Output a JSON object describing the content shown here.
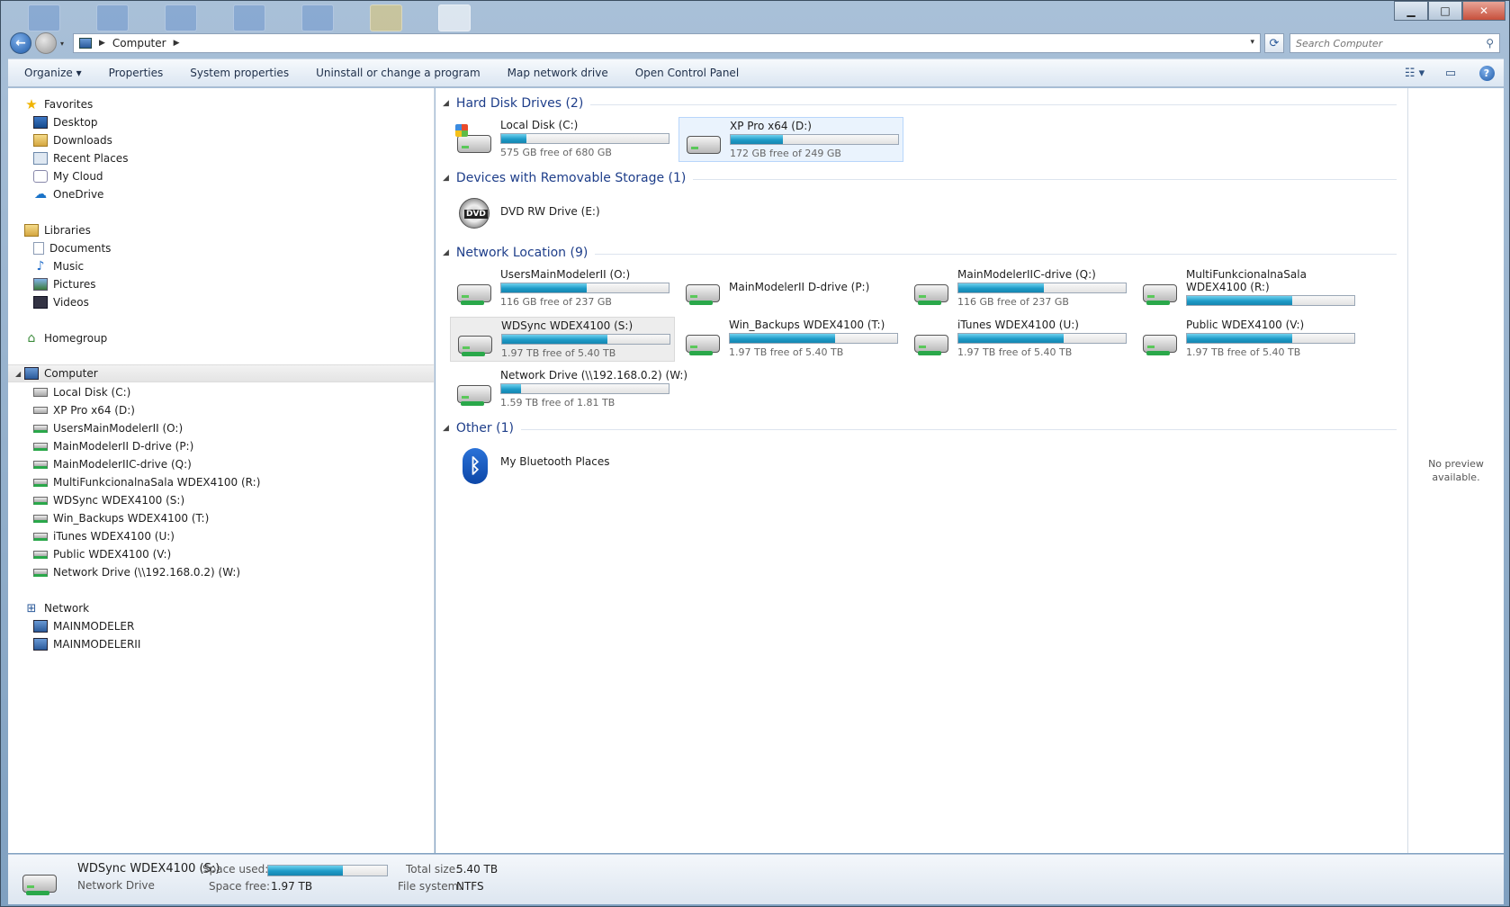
{
  "window": {
    "controls": {
      "minimize": "▁",
      "maximize": "□",
      "close": "✕"
    }
  },
  "address": {
    "crumb": "Computer",
    "search_placeholder": "Search Computer"
  },
  "toolbar": {
    "items": [
      "Organize ▾",
      "Properties",
      "System properties",
      "Uninstall or change a program",
      "Map network drive",
      "Open Control Panel"
    ]
  },
  "nav": {
    "favorites": "Favorites",
    "favorites_items": [
      "Desktop",
      "Downloads",
      "Recent Places",
      "My Cloud",
      "OneDrive"
    ],
    "libraries": "Libraries",
    "libraries_items": [
      "Documents",
      "Music",
      "Pictures",
      "Videos"
    ],
    "homegroup": "Homegroup",
    "computer": "Computer",
    "computer_items": [
      "Local Disk (C:)",
      "XP Pro x64 (D:)",
      "UsersMainModelerII (O:)",
      "MainModelerII D-drive (P:)",
      "MainModelerIIC-drive (Q:)",
      "MultiFunkcionalnaSala WDEX4100 (R:)",
      "WDSync WDEX4100 (S:)",
      "Win_Backups WDEX4100 (T:)",
      "iTunes WDEX4100 (U:)",
      "Public WDEX4100 (V:)",
      "Network Drive (\\\\192.168.0.2) (W:)"
    ],
    "network": "Network",
    "network_items": [
      "MAINMODELER",
      "MAINMODELERII"
    ]
  },
  "groups": {
    "hdd": "Hard Disk Drives (2)",
    "removable": "Devices with Removable Storage (1)",
    "netloc": "Network Location (9)",
    "other": "Other (1)"
  },
  "drives": {
    "c": {
      "name": "Local Disk (C:)",
      "free": "575 GB free of 680 GB",
      "used_pct": 15
    },
    "d": {
      "name": "XP Pro x64 (D:)",
      "free": "172 GB free of 249 GB",
      "used_pct": 31
    },
    "e": {
      "name": "DVD RW Drive (E:)"
    },
    "o": {
      "name": "UsersMainModelerII (O:)",
      "free": "116 GB free of 237 GB",
      "used_pct": 51
    },
    "p": {
      "name": "MainModelerII D-drive (P:)"
    },
    "q": {
      "name": "MainModelerIIC-drive (Q:)",
      "free": "116 GB free of 237 GB",
      "used_pct": 51
    },
    "r": {
      "name": "MultiFunkcionalnaSala WDEX4100 (R:)",
      "used_pct": 63
    },
    "s": {
      "name": "WDSync WDEX4100 (S:)",
      "free": "1.97 TB free of 5.40 TB",
      "used_pct": 63
    },
    "t": {
      "name": "Win_Backups WDEX4100 (T:)",
      "free": "1.97 TB free of 5.40 TB",
      "used_pct": 63
    },
    "u": {
      "name": "iTunes WDEX4100 (U:)",
      "free": "1.97 TB free of 5.40 TB",
      "used_pct": 63
    },
    "v": {
      "name": "Public WDEX4100 (V:)",
      "free": "1.97 TB free of 5.40 TB",
      "used_pct": 63
    },
    "w": {
      "name": "Network Drive (\\\\192.168.0.2) (W:)",
      "free": "1.59 TB free of 1.81 TB",
      "used_pct": 12
    },
    "bt": {
      "name": "My Bluetooth Places"
    }
  },
  "preview": {
    "text": "No preview available."
  },
  "details": {
    "name": "WDSync WDEX4100 (S:)",
    "type": "Network Drive",
    "space_used_label": "Space used:",
    "space_used_pct": 63,
    "space_free_label": "Space free:",
    "space_free_value": "1.97 TB",
    "total_size_label": "Total size:",
    "total_size_value": "5.40 TB",
    "fs_label": "File system:",
    "fs_value": "NTFS"
  },
  "colors": {
    "accent": "#1e9bc8",
    "group_title": "#1e3e8a",
    "selection": "#eaf3fd"
  },
  "icons": {
    "nav_back": "←",
    "refresh": "⟳",
    "search": "⚲",
    "dropdown": "▾",
    "view_options": "☷",
    "preview_pane": "▭",
    "help": "?",
    "star": "★",
    "onedrive": "☁",
    "music": "♪",
    "homegroup": "⌂",
    "network": "⊞",
    "bluetooth": "ᛒ",
    "collapse": "◢",
    "dvd_label": "DVD"
  }
}
